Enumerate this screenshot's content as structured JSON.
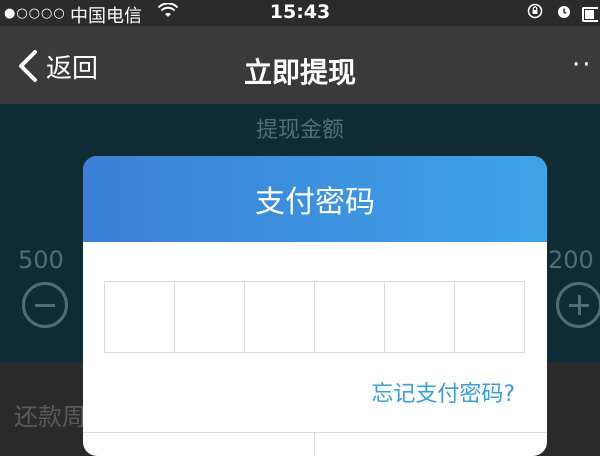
{
  "status_bar": {
    "signal": "●○○○○",
    "carrier": "中国电信",
    "wifi_icon": "wifi-icon",
    "time": "15:43",
    "icons": [
      "rotation-lock-icon",
      "alarm-icon",
      "battery-icon"
    ]
  },
  "nav": {
    "back_label": "返回",
    "title": "立即提现",
    "more_icon": "more-icon"
  },
  "page": {
    "amount_title": "提现金额",
    "min_amount": "500",
    "max_amount": "200",
    "repay_label": "还款周"
  },
  "dialog": {
    "title": "支付密码",
    "password_length": 6,
    "forgot_link": "忘记支付密码?"
  },
  "colors": {
    "header_gradient_start": "#3b7fd6",
    "header_gradient_end": "#3ea3e7",
    "link": "#3a9fd8",
    "nav_bg": "#3a3a3a"
  }
}
